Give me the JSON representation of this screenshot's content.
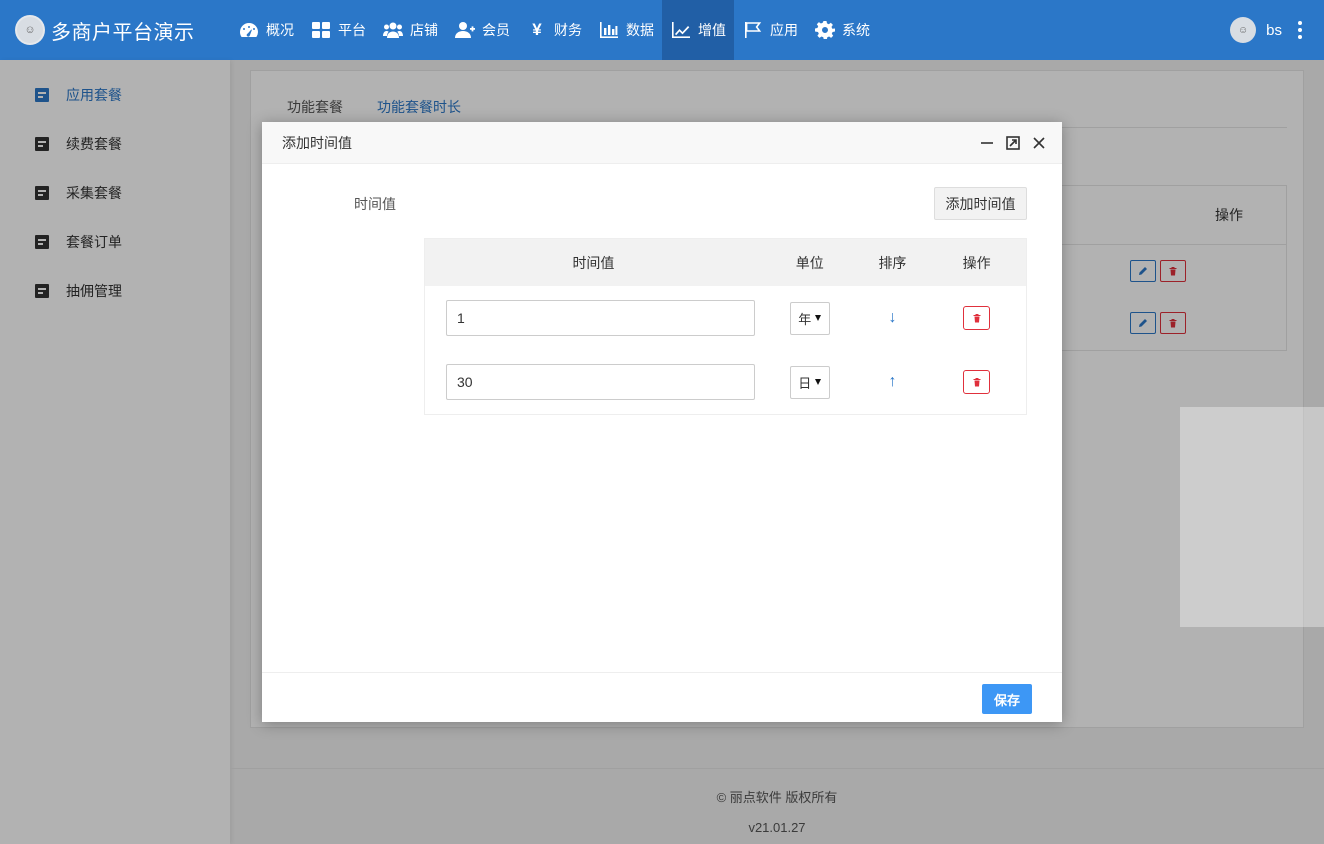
{
  "header": {
    "brand_title": "多商户平台演示",
    "nav": [
      {
        "label": "概况",
        "icon": "dashboard-icon"
      },
      {
        "label": "平台",
        "icon": "grid-icon"
      },
      {
        "label": "店铺",
        "icon": "users-icon"
      },
      {
        "label": "会员",
        "icon": "user-plus-icon"
      },
      {
        "label": "财务",
        "icon": "yen-icon"
      },
      {
        "label": "数据",
        "icon": "bar-chart-icon"
      },
      {
        "label": "增值",
        "icon": "line-chart-icon",
        "active": true
      },
      {
        "label": "应用",
        "icon": "flag-icon"
      },
      {
        "label": "系统",
        "icon": "gear-icon"
      }
    ],
    "user_name": "bs"
  },
  "sidebar": {
    "items": [
      {
        "label": "应用套餐",
        "active": true
      },
      {
        "label": "续费套餐"
      },
      {
        "label": "采集套餐"
      },
      {
        "label": "套餐订单"
      },
      {
        "label": "抽佣管理"
      }
    ]
  },
  "main": {
    "tabs": [
      {
        "label": "功能套餐"
      },
      {
        "label": "功能套餐时长",
        "active": true
      }
    ],
    "table_header_ops": "操作"
  },
  "modal": {
    "title": "添加时间值",
    "field_label": "时间值",
    "add_button": "添加时间值",
    "columns": [
      "时间值",
      "单位",
      "排序",
      "操作"
    ],
    "rows": [
      {
        "value": "1",
        "unit": "年",
        "sort_arrow": "↓"
      },
      {
        "value": "30",
        "unit": "日",
        "sort_arrow": "↑"
      }
    ],
    "save_button": "保存"
  },
  "footer": {
    "copyright": "© 丽点软件 版权所有",
    "version": "v21.01.27"
  },
  "colors": {
    "primary": "#2b77c8",
    "danger": "#e0303c",
    "save": "#3d97f5"
  }
}
